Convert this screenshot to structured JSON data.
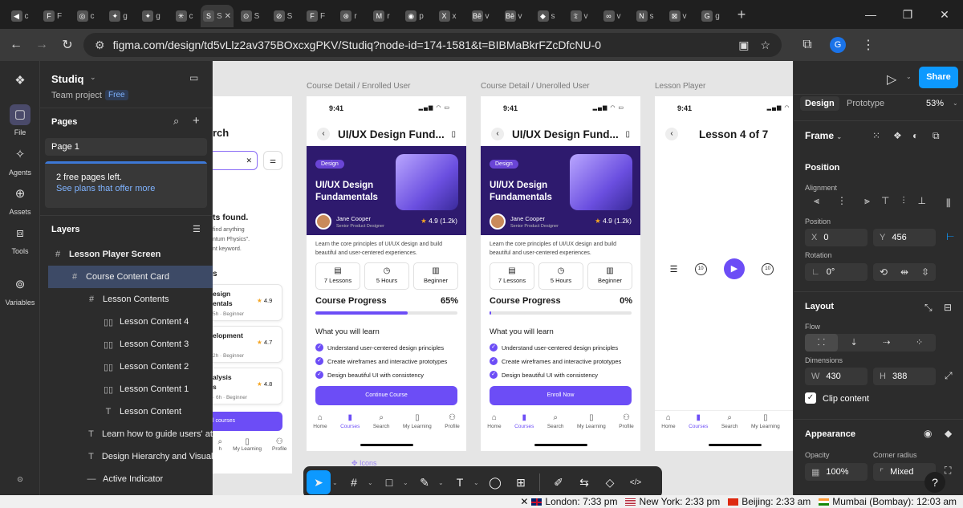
{
  "browser": {
    "tabs": [
      {
        "icon": "pinned-tab-icon",
        "letter": "◀",
        "title": "c"
      },
      {
        "icon": "figma-favicon-icon",
        "letter": "F",
        "title": "F"
      },
      {
        "icon": "openai-favicon-icon",
        "letter": "◎",
        "title": "c"
      },
      {
        "icon": "gemini-favicon-icon",
        "letter": "✦",
        "title": "g"
      },
      {
        "icon": "gemini-favicon-icon",
        "letter": "✦",
        "title": "g"
      },
      {
        "icon": "claude-favicon-icon",
        "letter": "✳",
        "title": "c"
      },
      {
        "icon": "site-favicon-icon",
        "letter": "S",
        "title": "S"
      },
      {
        "icon": "site-favicon-icon",
        "letter": "⊙",
        "title": "S"
      },
      {
        "icon": "site-favicon-icon",
        "letter": "⊘",
        "title": "S"
      },
      {
        "icon": "figma-favicon-icon",
        "letter": "F",
        "title": "F"
      },
      {
        "icon": "site-favicon-icon",
        "letter": "⊛",
        "title": "r"
      },
      {
        "icon": "medium-favicon-icon",
        "letter": "M",
        "title": "r"
      },
      {
        "icon": "site-favicon-icon",
        "letter": "◉",
        "title": "p"
      },
      {
        "icon": "x-favicon-icon",
        "letter": "X",
        "title": "x"
      },
      {
        "icon": "behance-favicon-icon",
        "letter": "Bē",
        "title": "v"
      },
      {
        "icon": "behance-favicon-icon",
        "letter": "Bē",
        "title": "v"
      },
      {
        "icon": "site-favicon-icon",
        "letter": "◆",
        "title": "s"
      },
      {
        "icon": "site-favicon-icon",
        "letter": "𝔗",
        "title": "v"
      },
      {
        "icon": "meta-favicon-icon",
        "letter": "∞",
        "title": "v"
      },
      {
        "icon": "notion-favicon-icon",
        "letter": "N",
        "title": "s"
      },
      {
        "icon": "site-favicon-icon",
        "letter": "⊠",
        "title": "v"
      },
      {
        "icon": "google-favicon-icon",
        "letter": "G",
        "title": "g"
      }
    ],
    "active_tab_index": 6,
    "url": "figma.com/design/td5vLlz2av375BOxcxgPKV/Studiq?node-id=174-1581&t=BIBMaBkrFZcDfcNU-0",
    "profile_letter": "G"
  },
  "rail": {
    "file": "File",
    "agents": "Agents",
    "assets": "Assets",
    "tools": "Tools",
    "variables": "Variables"
  },
  "left_panel": {
    "project_name": "Studiq",
    "team": "Team project",
    "plan_badge": "Free",
    "pages_heading": "Pages",
    "page_1": "Page 1",
    "free_pages": "2 free pages left.",
    "see_plans": "See plans that offer more",
    "layers_heading": "Layers",
    "layers": [
      {
        "label": "Lesson Player Screen",
        "glyph": "#",
        "indent": 0,
        "bold": true
      },
      {
        "label": "Course Content Card",
        "glyph": "#",
        "indent": 1,
        "selected": true
      },
      {
        "label": "Lesson Contents",
        "glyph": "#",
        "indent": 2
      },
      {
        "label": "Lesson Content 4",
        "glyph": "▯▯",
        "indent": 3
      },
      {
        "label": "Lesson Content 3",
        "glyph": "▯▯",
        "indent": 3
      },
      {
        "label": "Lesson Content 2",
        "glyph": "▯▯",
        "indent": 3
      },
      {
        "label": "Lesson Content 1",
        "glyph": "▯▯",
        "indent": 3
      },
      {
        "label": "Lesson Content",
        "glyph": "T",
        "indent": 3
      },
      {
        "label": "Learn how to guide users' atte",
        "glyph": "T",
        "indent": 2
      },
      {
        "label": "Design Hierarchy and Visual F",
        "glyph": "T",
        "indent": 2
      },
      {
        "label": "Active Indicator",
        "glyph": "—",
        "indent": 2
      }
    ]
  },
  "canvas": {
    "frames": [
      {
        "label": "Course Detail / Enrolled User",
        "progress": 65,
        "progress_text": "65%",
        "cta": "Continue Course"
      },
      {
        "label": "Course Detail / Unerolled User",
        "progress": 0,
        "progress_text": "0%",
        "cta": "Enroll Now"
      },
      {
        "label": "Lesson Player"
      }
    ],
    "partial_frame": {
      "title_fragment": "rch",
      "results": "ts found.",
      "hint_1": "find anything",
      "hint_2": "ntum Physics\".",
      "hint_3": "nt keyword.",
      "section": "s",
      "cards": [
        {
          "l1": "esign",
          "l2": "entals",
          "meta": "5h · Beginner",
          "rating": "4.9"
        },
        {
          "l1": "elopment",
          "l2": "",
          "meta": "2h · Beginner",
          "rating": "4.7"
        },
        {
          "l1": "alysis",
          "l2": "s",
          "meta": "· 6h · Beginner",
          "rating": "4.8"
        }
      ],
      "button": "l courses",
      "tabs": [
        "h",
        "My Learning",
        "Profile"
      ]
    },
    "course": {
      "time": "9:41",
      "title": "UI/UX Design Fund...",
      "tag": "Design",
      "hero_title": "UI/UX Design Fundamentals",
      "instructor": "Jane Cooper",
      "role": "Senior Product Designer",
      "rating": "4.9 (1.2k)",
      "description": "Learn the core principles of UI/UX design and build beautiful and user-centered experiences.",
      "stats": [
        {
          "icon": "lessons-icon",
          "glyph": "▤",
          "label": "7 Lessons"
        },
        {
          "icon": "clock-icon",
          "glyph": "◷",
          "label": "5 Hours"
        },
        {
          "icon": "level-icon",
          "glyph": "▥",
          "label": "Beginner"
        }
      ],
      "progress_label": "Course Progress",
      "learn_heading": "What you will learn",
      "learn_items": [
        "Understand user-centered design principles",
        "Create wireframes and interactive prototypes",
        "Design beautiful UI with consistency"
      ],
      "tabs": [
        {
          "icon": "home-icon",
          "glyph": "⌂",
          "label": "Home"
        },
        {
          "icon": "courses-icon",
          "glyph": "▮",
          "label": "Courses",
          "active": true
        },
        {
          "icon": "search-icon",
          "glyph": "⌕",
          "label": "Search"
        },
        {
          "icon": "bookmark-icon",
          "glyph": "▯",
          "label": "My Learning"
        },
        {
          "icon": "profile-icon",
          "glyph": "⚇",
          "label": "Profile"
        }
      ]
    },
    "player": {
      "time": "9:41",
      "title": "Lesson 4 of 7",
      "rewind": "10",
      "forward": "10"
    },
    "below_label": "Icons"
  },
  "right_panel": {
    "share": "Share",
    "tab_design": "Design",
    "tab_prototype": "Prototype",
    "zoom": "53%",
    "frame": "Frame",
    "position_heading": "Position",
    "alignment": "Alignment",
    "position_label": "Position",
    "x_key": "X",
    "x": "0",
    "y_key": "Y",
    "y": "456",
    "rotation_label": "Rotation",
    "rotation": "0°",
    "layout_heading": "Layout",
    "flow": "Flow",
    "dimensions": "Dimensions",
    "w_key": "W",
    "w": "430",
    "h_key": "H",
    "h": "388",
    "clip": "Clip content",
    "appearance": "Appearance",
    "opacity_label": "Opacity",
    "opacity": "100%",
    "radius_label": "Corner radius",
    "radius": "Mixed"
  },
  "toolbar": {
    "tools": [
      {
        "name": "move-tool-icon",
        "glyph": "➤",
        "selected": true
      },
      {
        "name": "frame-tool-icon",
        "glyph": "#"
      },
      {
        "name": "shape-tool-icon",
        "glyph": "□"
      },
      {
        "name": "pen-tool-icon",
        "glyph": "✎"
      },
      {
        "name": "text-tool-icon",
        "glyph": "T"
      },
      {
        "name": "comment-tool-icon",
        "glyph": "◯"
      },
      {
        "name": "actions-tool-icon",
        "glyph": "⊞"
      },
      {
        "name": "draw-tool-icon",
        "glyph": "✐"
      },
      {
        "name": "dev-mode-icon",
        "glyph": "⇆"
      },
      {
        "name": "component-icon",
        "glyph": "◇"
      },
      {
        "name": "code-icon",
        "glyph": "</>"
      }
    ]
  },
  "taskbar": {
    "clocks": [
      {
        "flag": "uk",
        "text": "London: 7:33 pm"
      },
      {
        "flag": "us",
        "text": "New York: 2:33 pm"
      },
      {
        "flag": "cn",
        "text": "Beijing: 2:33 am"
      },
      {
        "flag": "in",
        "text": "Mumbai (Bombay): 12:03 am"
      }
    ]
  }
}
